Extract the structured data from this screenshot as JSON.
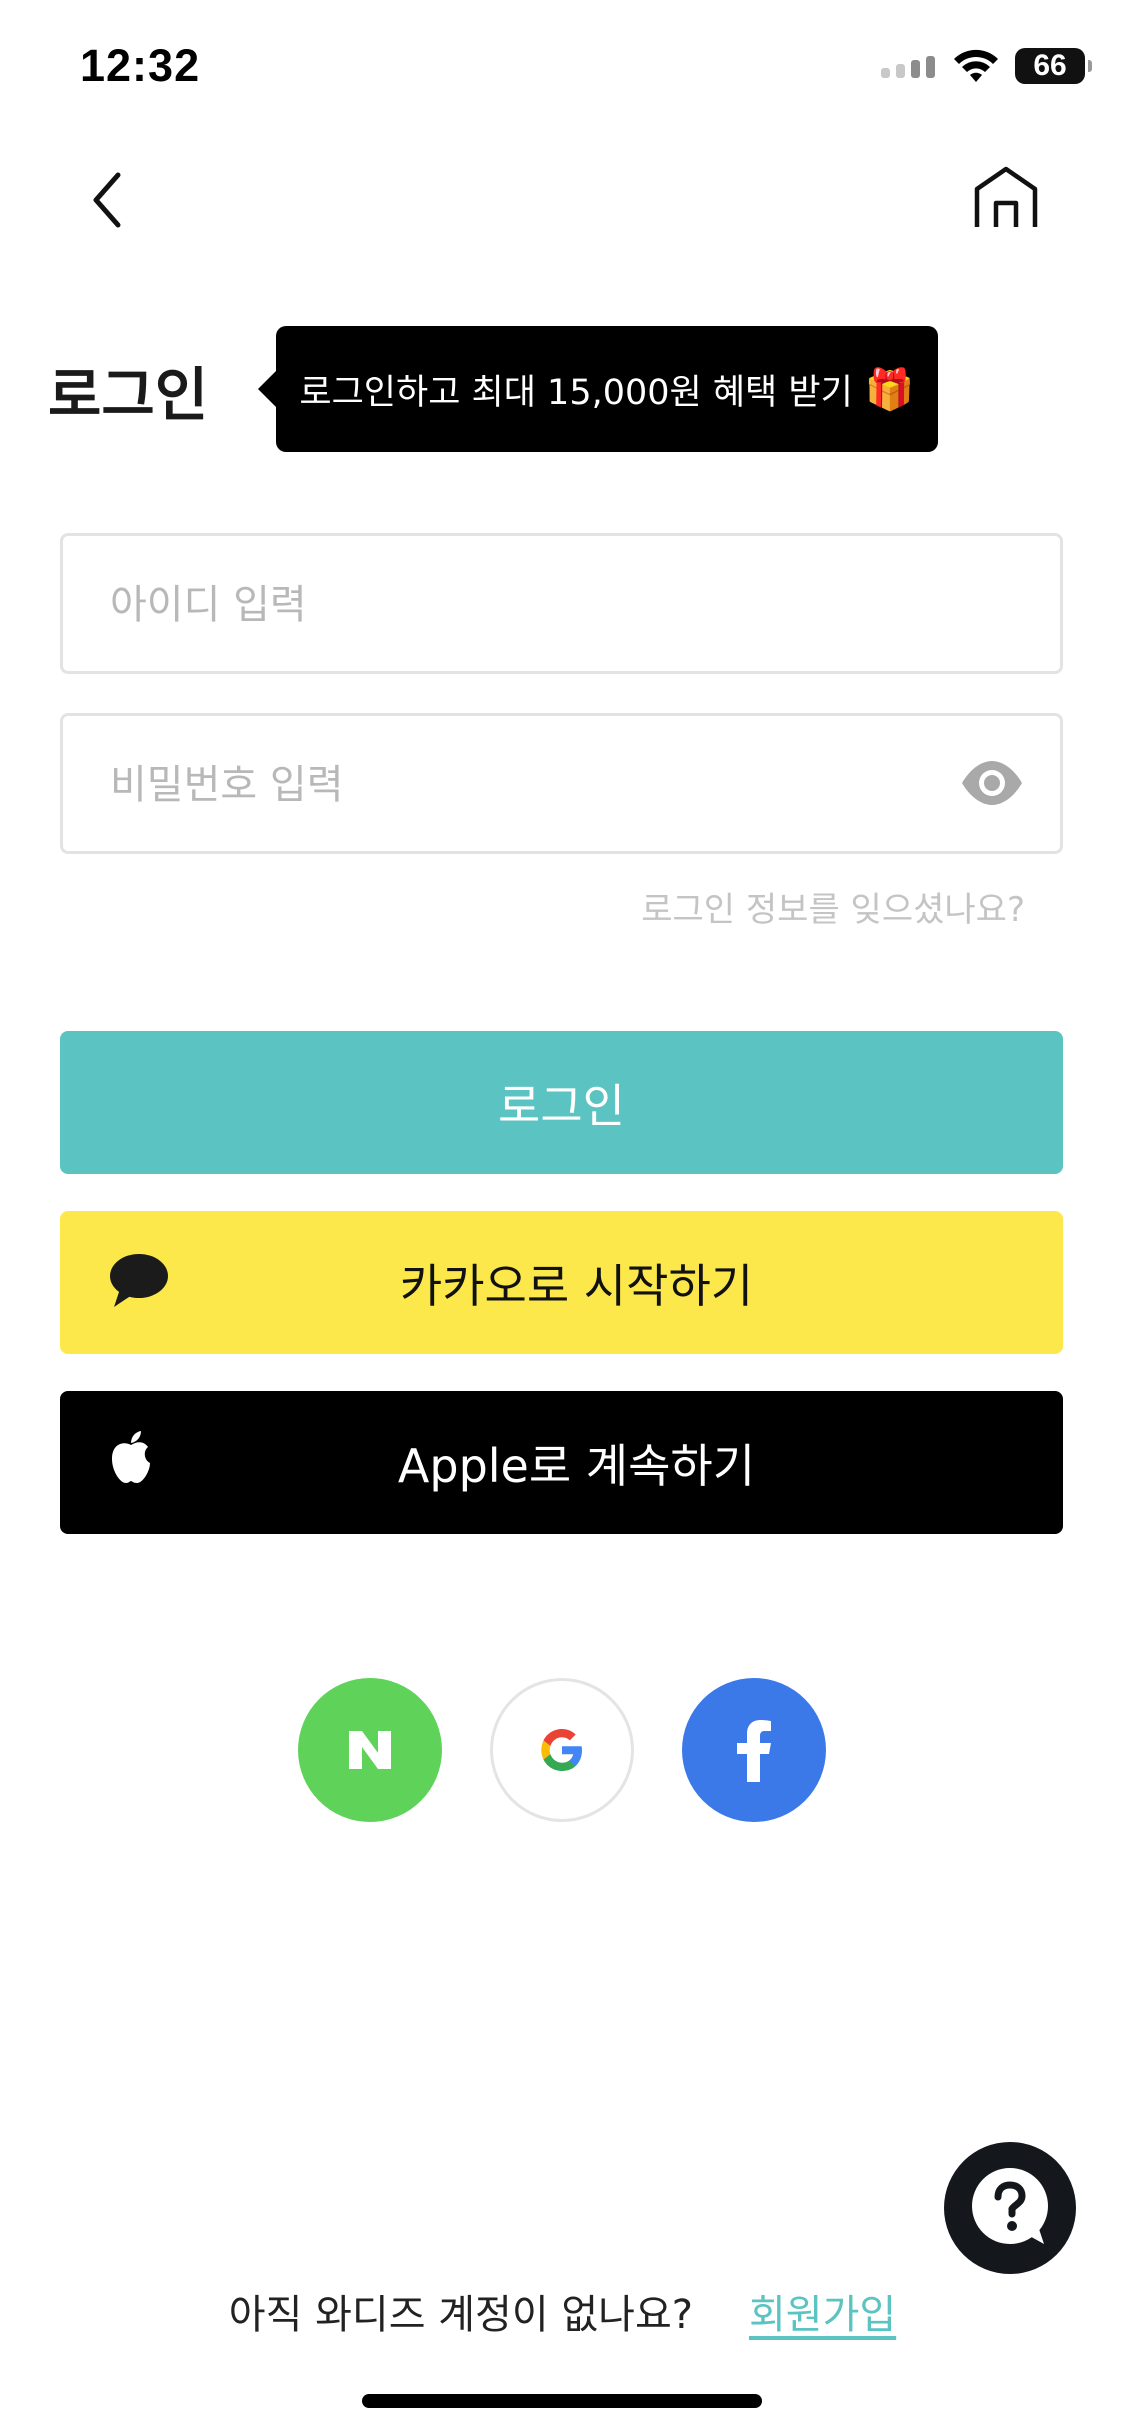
{
  "status_bar": {
    "time": "12:32",
    "battery": "66"
  },
  "header": {
    "back_icon": "chevron-left-icon",
    "home_icon": "home-icon"
  },
  "title": "로그인",
  "tooltip": {
    "text": "로그인하고 최대 15,000원 혜택 받기",
    "emoji": "🎁"
  },
  "form": {
    "id_placeholder": "아이디 입력",
    "password_placeholder": "비밀번호 입력",
    "forgot_label": "로그인 정보를 잊으셨나요?"
  },
  "buttons": {
    "login": "로그인",
    "kakao": "카카오로 시작하기",
    "apple": "Apple로 계속하기"
  },
  "social": {
    "naver_letter": "N",
    "google_letter": "G",
    "facebook_letter": "f"
  },
  "help": {
    "glyph": "?"
  },
  "footer": {
    "question": "아직 와디즈 계정이 없나요?",
    "signup": "회원가입"
  },
  "colors": {
    "accent": "#5bc3c1",
    "kakao": "#fce84a",
    "apple": "#000000",
    "naver": "#5fd25a",
    "facebook": "#3b79e8"
  }
}
